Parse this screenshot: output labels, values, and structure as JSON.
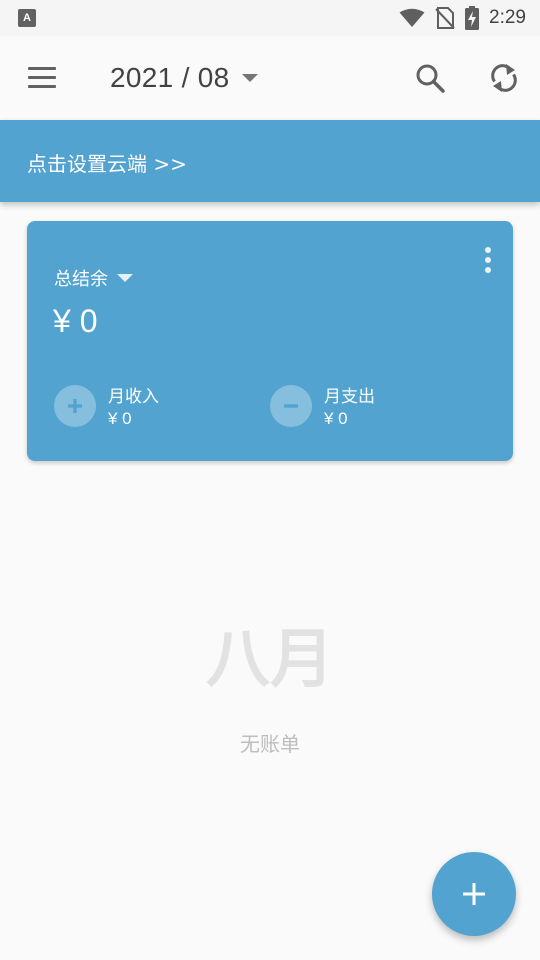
{
  "status_bar": {
    "time": "2:29",
    "icons": [
      "app-notification-icon",
      "wifi-icon",
      "no-sim-icon",
      "battery-charging-icon"
    ]
  },
  "app_bar": {
    "date": "2021 / 08",
    "icons": [
      "menu-icon",
      "dropdown-caret-icon",
      "search-icon",
      "sync-icon"
    ]
  },
  "cloud_banner": {
    "text": "点击设置云端 >>"
  },
  "balance_card": {
    "label": "总结余",
    "amount": "¥ 0",
    "income": {
      "label": "月收入",
      "value": "¥ 0"
    },
    "expense": {
      "label": "月支出",
      "value": "¥ 0"
    }
  },
  "empty_state": {
    "title": "八月",
    "text": "无账单"
  },
  "colors": {
    "accent": "#52a3d0",
    "background": "#fafafa",
    "empty_text": "#bdbdbd"
  }
}
